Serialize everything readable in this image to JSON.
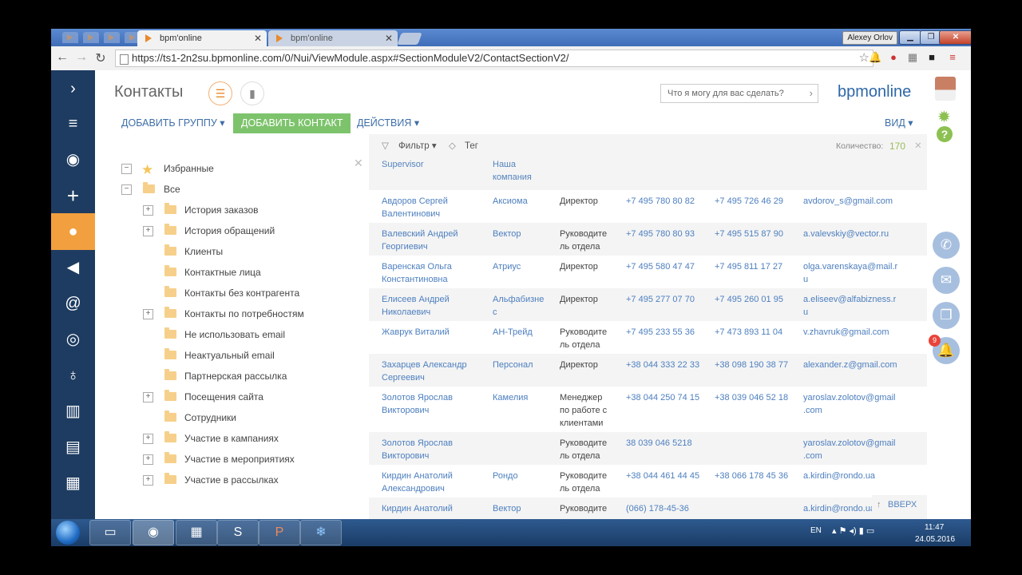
{
  "browser": {
    "tabs": [
      {
        "title": "bpm'online",
        "active": true
      },
      {
        "title": "bpm'online",
        "active": false
      }
    ],
    "user_badge": "Alexey Orlov",
    "url": "https://ts1-2n2su.bpmonline.com/0/Nui/ViewModule.aspx#SectionModuleV2/ContactSectionV2/"
  },
  "app": {
    "page_title": "Контакты",
    "search_placeholder": "Что я могу для вас сделать?",
    "logo": "bpmonline",
    "toolbar": {
      "add_group": "ДОБАВИТЬ ГРУППУ",
      "add_contact": "ДОБАВИТЬ КОНТАКТ",
      "actions": "ДЕЙСТВИЯ",
      "view": "ВИД"
    },
    "left_nav_icons": [
      "chevron-right",
      "menu",
      "play",
      "plus",
      "contact",
      "megaphone",
      "at",
      "target",
      "balloon",
      "building-chart",
      "building",
      "calendar"
    ],
    "tree": {
      "favorites": "Избранные",
      "all": "Все",
      "folders": [
        {
          "label": "История заказов",
          "expandable": true
        },
        {
          "label": "История обращений",
          "expandable": true
        },
        {
          "label": "Клиенты",
          "expandable": false
        },
        {
          "label": "Контактные лица",
          "expandable": false
        },
        {
          "label": "Контакты без контрагента",
          "expandable": false
        },
        {
          "label": "Контакты по потребностям",
          "expandable": true
        },
        {
          "label": "Не использовать email",
          "expandable": false
        },
        {
          "label": "Неактуальный email",
          "expandable": false
        },
        {
          "label": "Партнерская рассылка",
          "expandable": false
        },
        {
          "label": "Посещения сайта",
          "expandable": true
        },
        {
          "label": "Сотрудники",
          "expandable": false
        },
        {
          "label": "Участие в кампаниях",
          "expandable": true
        },
        {
          "label": "Участие в мероприятиях",
          "expandable": true
        },
        {
          "label": "Участие в рассылках",
          "expandable": true
        }
      ]
    },
    "grid": {
      "filter": "Фильтр",
      "tag": "Тег",
      "count_label": "Количество:",
      "count_value": "170",
      "headers": {
        "supervisor": "Supervisor",
        "company_line1": "Наша",
        "company_line2": "компания"
      },
      "rows": [
        {
          "name": [
            "Авдоров Сергей",
            "Валентинович"
          ],
          "company": [
            "Аксиома"
          ],
          "position": [
            "Директор"
          ],
          "phone1": "+7 495 780 80 82",
          "phone2": "+7 495 726 46 29",
          "email": [
            "avdorov_s@gmail.com"
          ]
        },
        {
          "name": [
            "Валевский Андрей",
            "Георгиевич"
          ],
          "company": [
            "Вектор"
          ],
          "position": [
            "Руководите",
            "ль отдела"
          ],
          "phone1": "+7 495 780 80 93",
          "phone2": "+7 495 515 87 90",
          "email": [
            "a.valevskiy@vector.ru"
          ]
        },
        {
          "name": [
            "Варенская Ольга",
            "Константиновна"
          ],
          "company": [
            "Атриус"
          ],
          "position": [
            "Директор"
          ],
          "phone1": "+7 495 580 47 47",
          "phone2": "+7 495 811 17 27",
          "email": [
            "olga.varenskaya@mail.r",
            "u"
          ]
        },
        {
          "name": [
            "Елисеев Андрей",
            "Николаевич"
          ],
          "company": [
            "Альфабизне",
            "с"
          ],
          "position": [
            "Директор"
          ],
          "phone1": "+7 495 277 07 70",
          "phone2": "+7 495 260 01 95",
          "email": [
            "a.eliseev@alfabizness.r",
            "u"
          ]
        },
        {
          "name": [
            "Жаврук Виталий"
          ],
          "company": [
            "АН-Трейд"
          ],
          "position": [
            "Руководите",
            "ль отдела"
          ],
          "phone1": "+7 495 233 55 36",
          "phone2": "+7 473 893 11 04",
          "email": [
            "v.zhavruk@gmail.com"
          ]
        },
        {
          "name": [
            "Захарцев Александр",
            "Сергеевич"
          ],
          "company": [
            "Персонал"
          ],
          "position": [
            "Директор"
          ],
          "phone1": "+38 044 333 22 33",
          "phone2": "+38 098 190 38 77",
          "email": [
            "alexander.z@gmail.com"
          ]
        },
        {
          "name": [
            "Золотов Ярослав",
            "Викторович"
          ],
          "company": [
            "Камелия"
          ],
          "position": [
            "Менеджер",
            "по работе с",
            "клиентами"
          ],
          "phone1": "+38 044 250 74 15",
          "phone2": "+38 039 046 52 18",
          "email": [
            "yaroslav.zolotov@gmail",
            ".com"
          ]
        },
        {
          "name": [
            "Золотов Ярослав",
            "Викторович"
          ],
          "company": [
            ""
          ],
          "position": [
            "Руководите",
            "ль отдела"
          ],
          "phone1": "38 039 046 5218",
          "phone2": "",
          "email": [
            "yaroslav.zolotov@gmail",
            ".com"
          ]
        },
        {
          "name": [
            "Кирдин Анатолий",
            "Александрович"
          ],
          "company": [
            "Рондо"
          ],
          "position": [
            "Руководите",
            "ль отдела"
          ],
          "phone1": "+38 044 461 44 45",
          "phone2": "+38 066 178 45 36",
          "email": [
            "a.kirdin@rondo.ua"
          ]
        },
        {
          "name": [
            "Кирдин Анатолий"
          ],
          "company": [
            "Вектор"
          ],
          "position": [
            "Руководите"
          ],
          "phone1": "(066) 178-45-36",
          "phone2": "",
          "email": [
            "a.kirdin@rondo.ua"
          ]
        }
      ],
      "scroll_up": "ВВЕРХ"
    },
    "right_panel": {
      "notification_count": "9"
    }
  },
  "taskbar": {
    "language": "EN",
    "time": "11:47",
    "date": "24.05.2016"
  },
  "colors": {
    "left_nav": "#1e3c61",
    "accent_orange": "#f29f3f",
    "green_button": "#7dc36c",
    "link_blue": "#4d7fbf"
  }
}
